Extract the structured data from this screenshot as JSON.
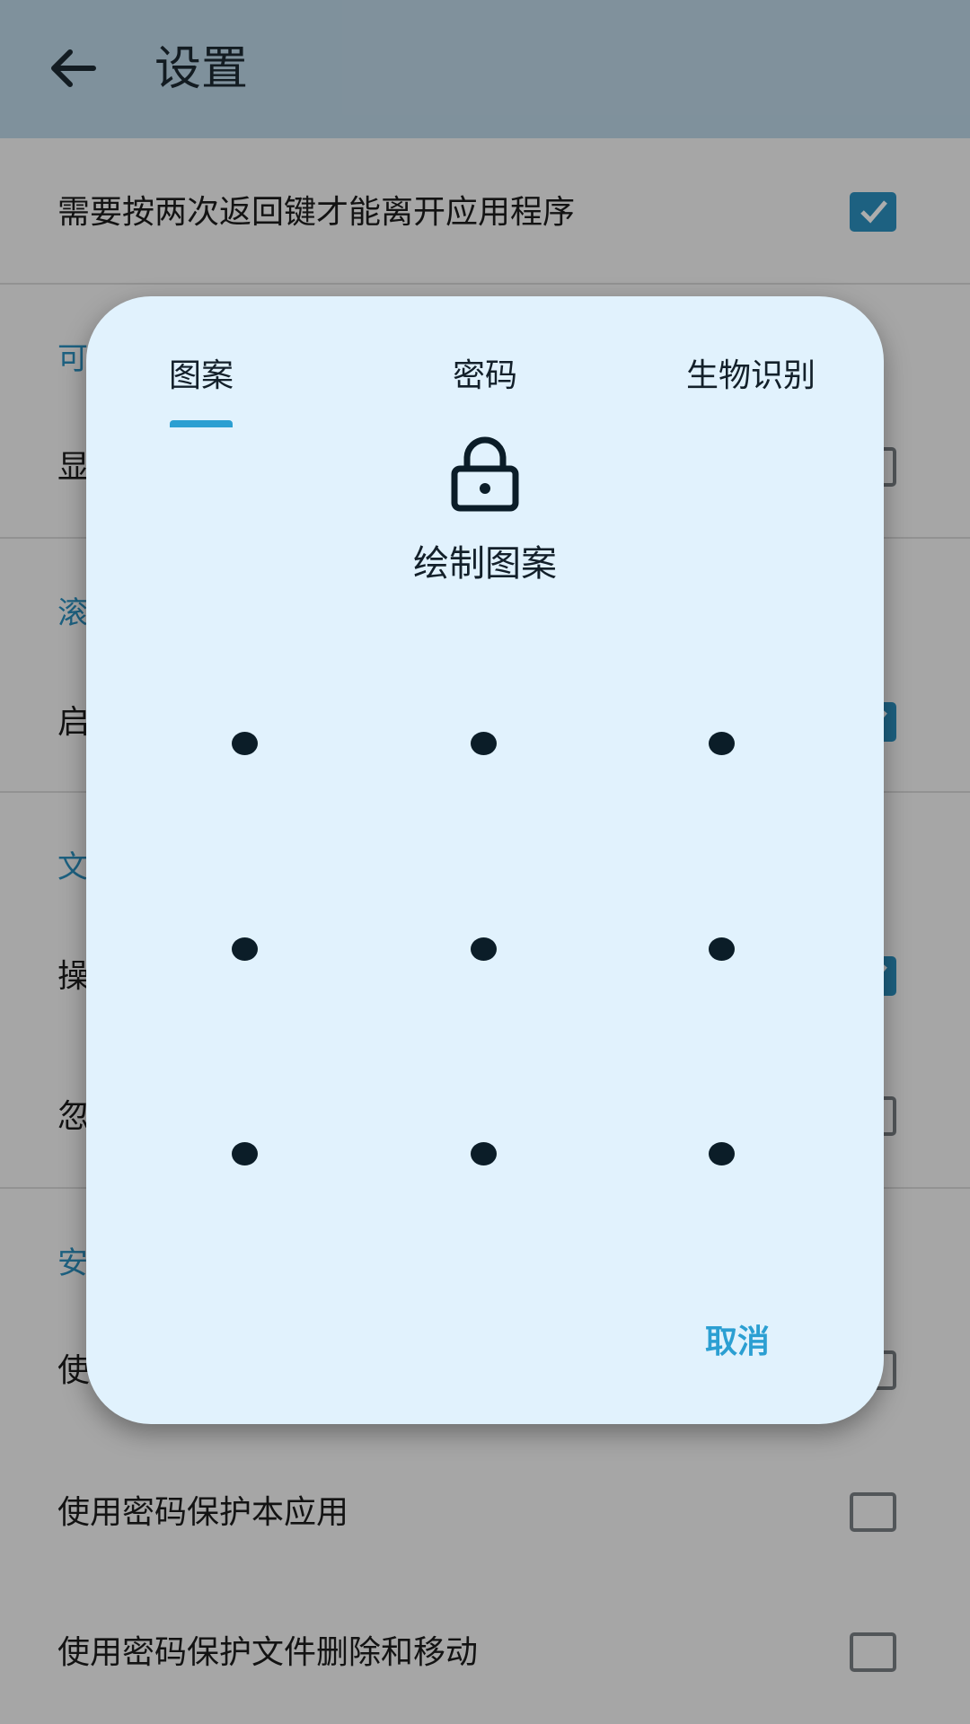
{
  "app_bar": {
    "title": "设置",
    "back_icon": "arrow-left-icon"
  },
  "settings": {
    "rows": [
      {
        "label": "需要按两次返回键才能离开应用程序",
        "checked": true
      },
      {
        "section": "可"
      },
      {
        "label": "显",
        "checked": false
      },
      {
        "section": "滚"
      },
      {
        "label": "启",
        "checked": true
      },
      {
        "section": "文"
      },
      {
        "label": "操",
        "checked": true
      },
      {
        "label": "忽",
        "checked": false
      },
      {
        "section": "安"
      },
      {
        "label": "使",
        "checked": false
      },
      {
        "label": "使用密码保护本应用",
        "checked": false
      },
      {
        "label": "使用密码保护文件删除和移动",
        "checked": false
      }
    ]
  },
  "dialog": {
    "tabs": [
      {
        "label": "图案",
        "selected": true
      },
      {
        "label": "密码",
        "selected": false
      },
      {
        "label": "生物识别",
        "selected": false
      }
    ],
    "icon": "lock-icon",
    "title": "绘制图案",
    "grid": "3x3",
    "cancel_label": "取消"
  },
  "colors": {
    "accent": "#2b9fd2",
    "dialog_bg": "#e1f2fd",
    "app_bar": "#bcd6e6",
    "dot": "#0b1d28"
  }
}
